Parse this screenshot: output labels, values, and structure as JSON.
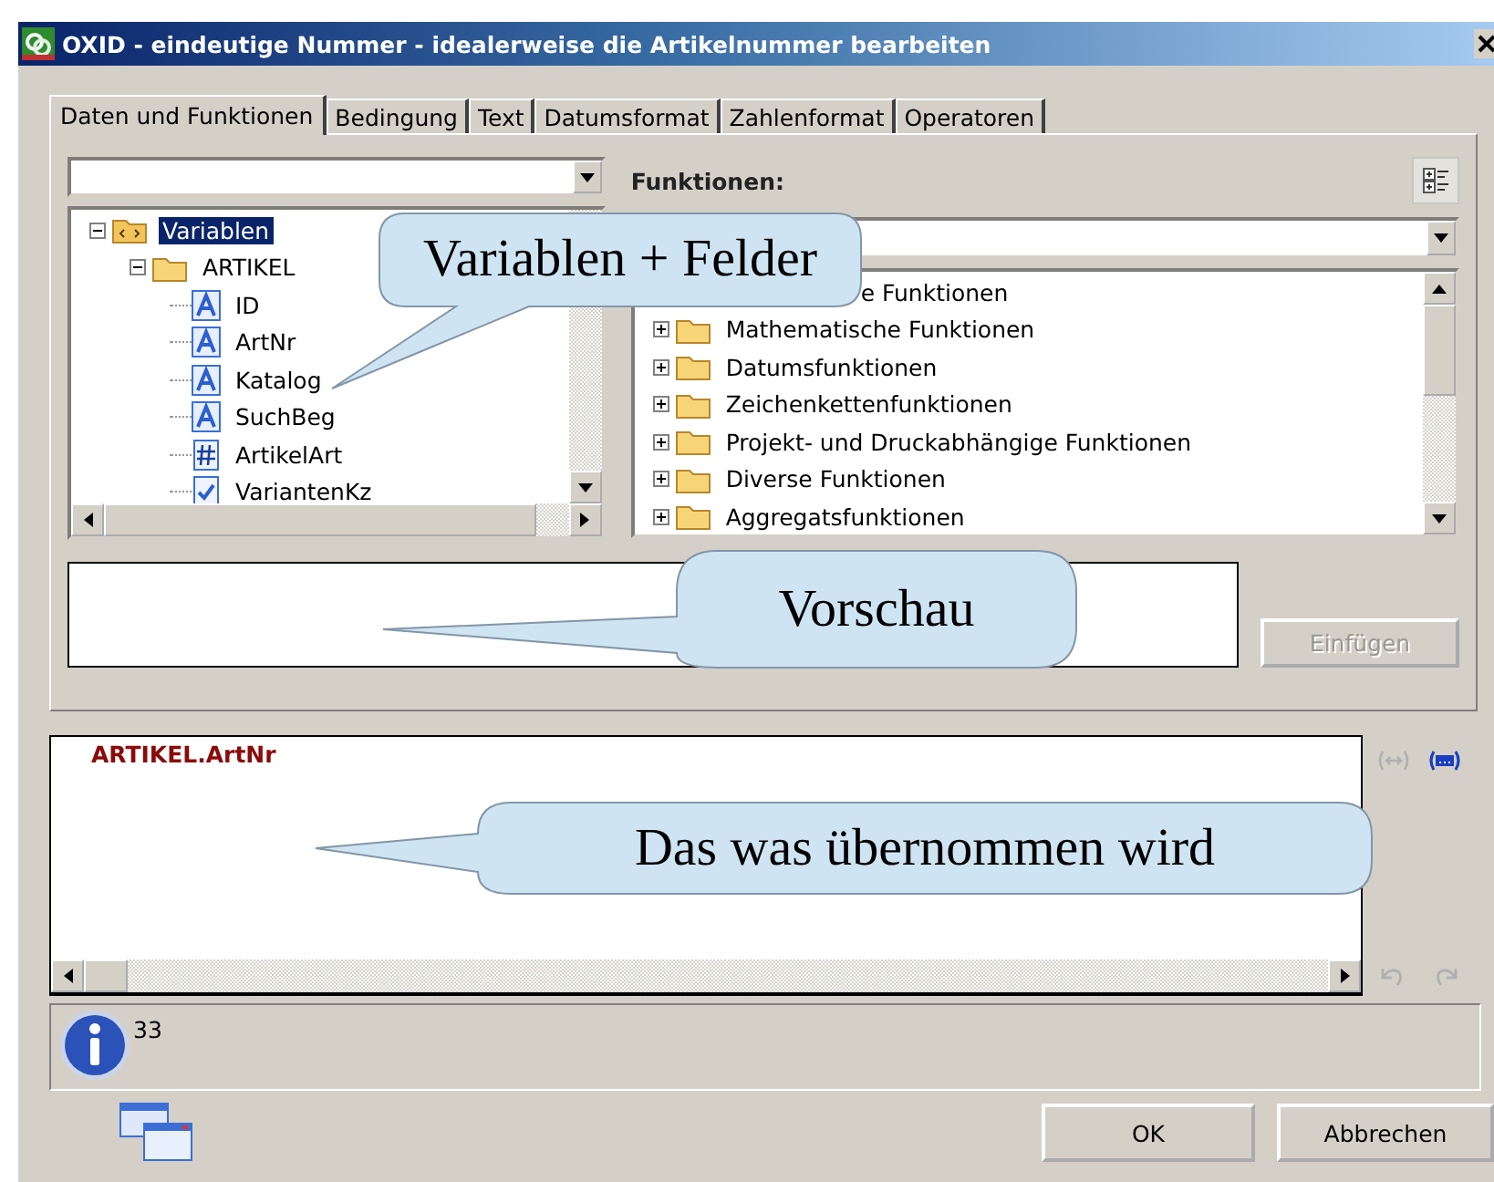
{
  "window": {
    "title": "OXID - eindeutige Nummer - idealerweise die Artikelnummer bearbeiten"
  },
  "tabs": [
    {
      "label": "Daten und Funktionen",
      "selected": true
    },
    {
      "label": "Bedingung",
      "selected": false
    },
    {
      "label": "Text",
      "selected": false
    },
    {
      "label": "Datumsformat",
      "selected": false
    },
    {
      "label": "Zahlenformat",
      "selected": false
    },
    {
      "label": "Operatoren",
      "selected": false
    }
  ],
  "variables_tree": {
    "items": [
      {
        "label": "Variablen",
        "kind": "root",
        "selected": true,
        "expanded": true,
        "children": [
          {
            "label": "ARTIKEL",
            "kind": "folder",
            "selected": false,
            "expanded": true,
            "children": [
              {
                "label": "ID",
                "kind": "text",
                "selected": false
              },
              {
                "label": "ArtNr",
                "kind": "text",
                "selected": false
              },
              {
                "label": "Katalog",
                "kind": "text",
                "selected": false
              },
              {
                "label": "SuchBeg",
                "kind": "text",
                "selected": false
              },
              {
                "label": "ArtikelArt",
                "kind": "number",
                "selected": false
              },
              {
                "label": "VariantenKz",
                "kind": "boolean",
                "selected": false
              }
            ]
          }
        ]
      }
    ]
  },
  "functions_label": "Funktionen:",
  "functions_list": [
    {
      "label": "e Funktionen",
      "expanded": false
    },
    {
      "label": "Mathematische Funktionen",
      "expanded": false
    },
    {
      "label": "Datumsfunktionen",
      "expanded": false
    },
    {
      "label": "Zeichenkettenfunktionen",
      "expanded": false
    },
    {
      "label": "Projekt- und Druckabhängige Funktionen",
      "expanded": false
    },
    {
      "label": "Diverse Funktionen",
      "expanded": false
    },
    {
      "label": "Aggregatsfunktionen",
      "expanded": false
    }
  ],
  "insert_button": {
    "label": "Einfügen",
    "disabled": true
  },
  "expression": "ARTIKEL.ArtNr",
  "info": {
    "text": "33"
  },
  "buttons": [
    {
      "label": "OK"
    },
    {
      "label": "Abbrechen"
    }
  ],
  "callouts": [
    {
      "text": "Variablen + Felder"
    },
    {
      "text": "Vorschau"
    },
    {
      "text": "Das was übernommen wird"
    }
  ]
}
